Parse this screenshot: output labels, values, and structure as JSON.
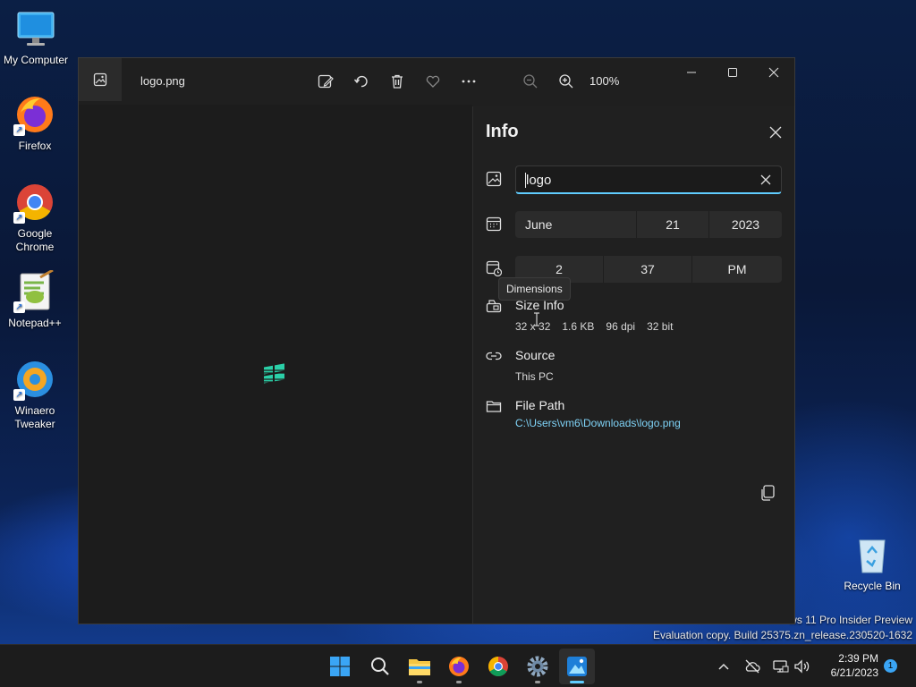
{
  "desktop": {
    "icons": [
      {
        "label": "My Computer",
        "icon": "monitor-icon"
      },
      {
        "label": "Firefox",
        "icon": "firefox-icon"
      },
      {
        "label": "Google Chrome",
        "icon": "chrome-icon"
      },
      {
        "label": "Notepad++",
        "icon": "notepad-plus-plus-icon"
      },
      {
        "label": "Winaero Tweaker",
        "icon": "winaero-tweaker-icon"
      },
      {
        "label": "Recycle Bin",
        "icon": "recycle-bin-icon"
      }
    ],
    "watermark": {
      "line1": "ws 11 Pro Insider Preview",
      "line2": "Evaluation copy. Build 25375.zn_release.230520-1632"
    }
  },
  "photos_window": {
    "file_name": "logo.png",
    "zoom_level": "100%",
    "toolbar": [
      "edit-image-icon",
      "rotate-icon",
      "delete-icon",
      "favorite-heart-icon",
      "more-options-icon"
    ],
    "zoom_out_icon": "zoom-out-icon",
    "zoom_in_icon": "zoom-in-icon",
    "info_panel": {
      "title": "Info",
      "name_value": "logo",
      "date": {
        "month": "June",
        "day": "21",
        "year": "2023"
      },
      "time": {
        "hour": "2",
        "minute": "37",
        "period": "PM"
      },
      "tooltip": "Dimensions",
      "size_info": {
        "label": "Size Info",
        "dimensions": "32 x 32",
        "file_size": "1.6 KB",
        "dpi": "96 dpi",
        "bit_depth": "32 bit"
      },
      "source": {
        "label": "Source",
        "value": "This PC"
      },
      "file_path": {
        "label": "File Path",
        "value": "C:\\Users\\vm6\\Downloads\\logo.png"
      }
    }
  },
  "taskbar": {
    "apps": [
      "start-icon",
      "search-icon",
      "file-explorer-icon",
      "firefox-icon",
      "chrome-icon",
      "settings-icon",
      "photos-icon"
    ],
    "clock": {
      "time": "2:39 PM",
      "date": "6/21/2023"
    },
    "notification_count": "1"
  },
  "colors": {
    "accent": "#60cdff",
    "window_bg": "#1f1f1f",
    "panel_bg": "#202020",
    "field_bg": "#2b2b2b",
    "link": "#7fd3f7"
  }
}
